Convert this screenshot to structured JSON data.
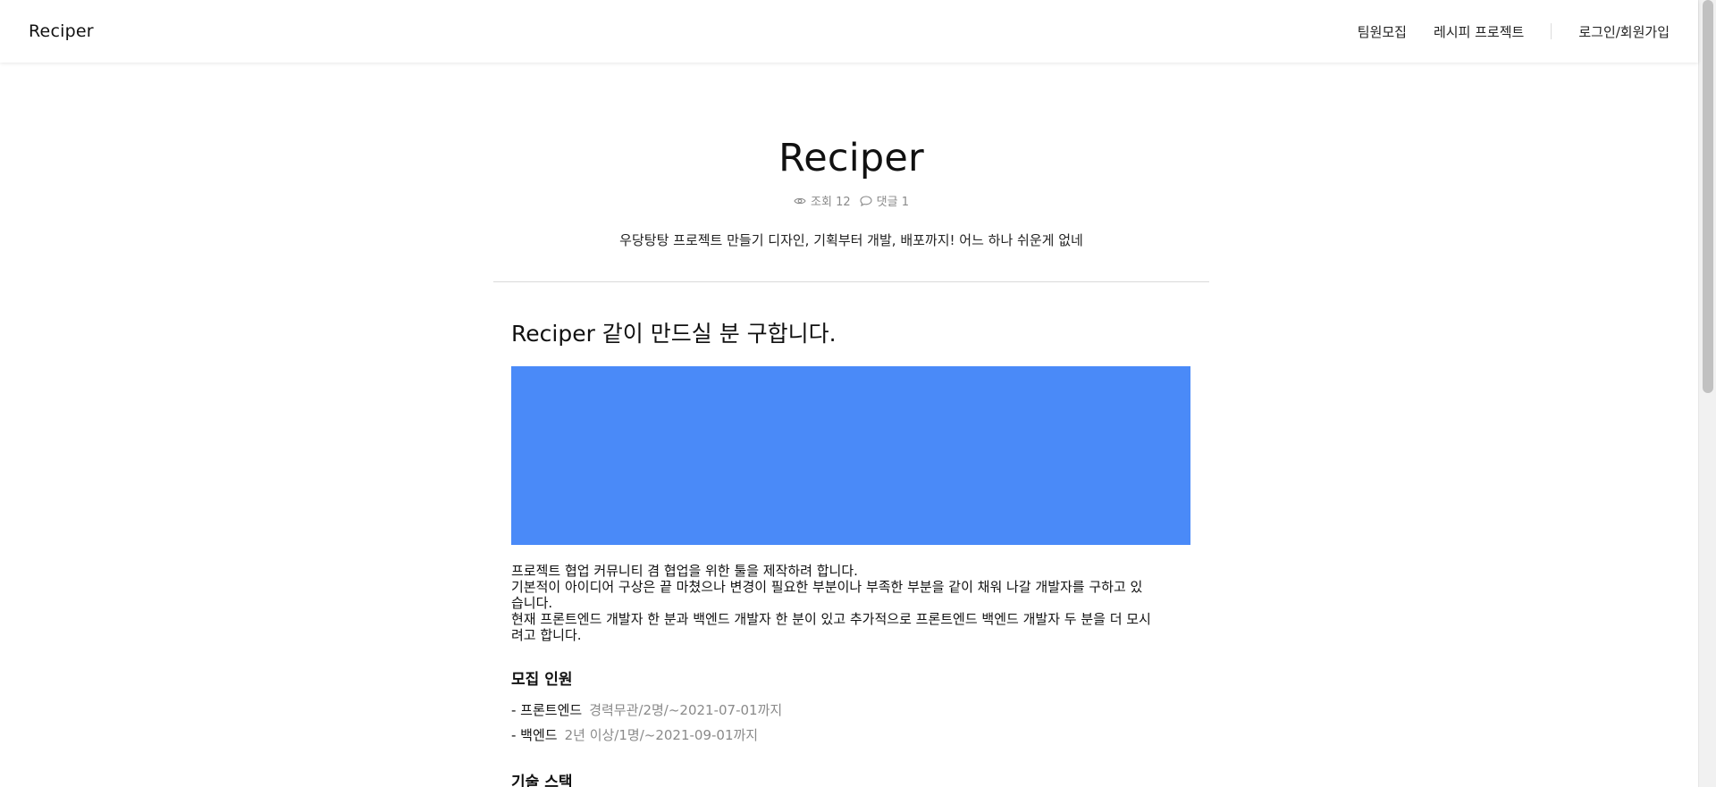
{
  "header": {
    "logo": "Reciper",
    "nav": [
      "팀원모집",
      "레시피 프로젝트"
    ],
    "auth": "로그인/회원가입"
  },
  "project": {
    "title": "Reciper",
    "views": "조회 12",
    "comments": "댓글 1",
    "subtitle": "우당탕탕 프로젝트 만들기 디자인, 기획부터 개발, 배포까지! 어느 하나 쉬운게 없네"
  },
  "post": {
    "heading": "Reciper 같이 만드실 분 구합니다.",
    "banner_color": "#4a8af8",
    "body": "프로젝트 협업 커뮤니티 겸 협업을 위한 툴을 제작하려 합니다.\n기본적이 아이디어 구상은 끝 마쳤으나 변경이 필요한 부분이나 부족한 부분을 같이 채워 나갈 개발자를 구하고 있습니다.\n현재 프론트엔드 개발자 한 분과 백엔드 개발자 한 분이 있고 추가적으로 프론트엔드 백엔드 개발자 두 분을 더 모시려고 합니다."
  },
  "recruit": {
    "title": "모집 인원",
    "items": [
      {
        "role": "- 프론트엔드",
        "detail": "경력무관/2명/~2021-07-01까지"
      },
      {
        "role": "- 백엔드",
        "detail": "2년 이상/1명/~2021-09-01까지"
      }
    ]
  },
  "stack": {
    "title": "기술 스택"
  },
  "colors": {
    "accent": "#4a8af8",
    "muted": "#8a8a8a",
    "tag_bg": "#e8ebf5"
  }
}
